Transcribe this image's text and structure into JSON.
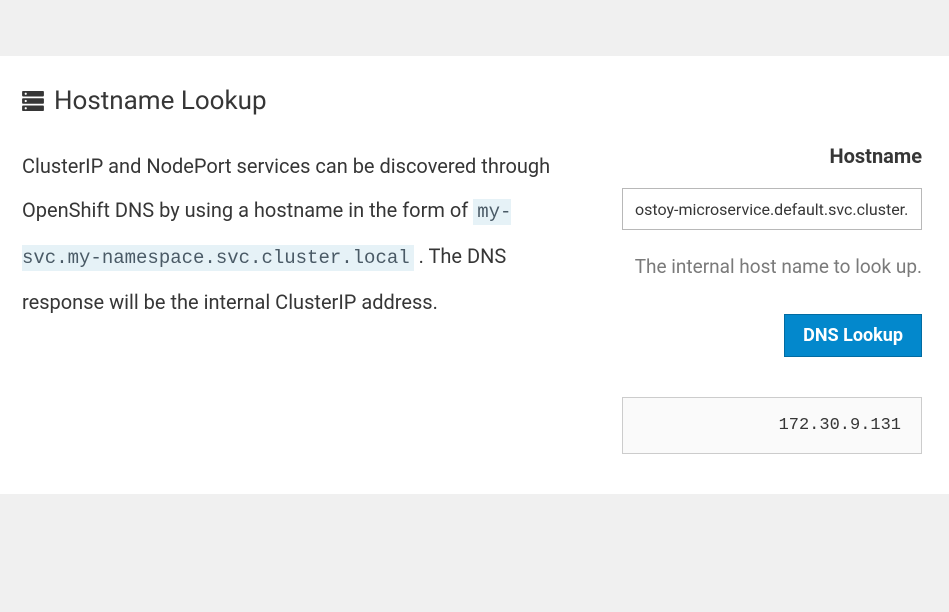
{
  "header": {
    "title": "Hostname Lookup"
  },
  "description": {
    "part1": "ClusterIP and NodePort services can be discovered through OpenShift DNS by using a hostname in the form of ",
    "code": "my-svc.my-namespace.svc.cluster.local",
    "part2": " . The DNS response will be the internal ClusterIP address."
  },
  "form": {
    "label": "Hostname",
    "input_value": "ostoy-microservice.default.svc.cluster.local",
    "help_text": "The internal host name to look up.",
    "button_label": "DNS Lookup"
  },
  "result": {
    "ip": "172.30.9.131"
  }
}
